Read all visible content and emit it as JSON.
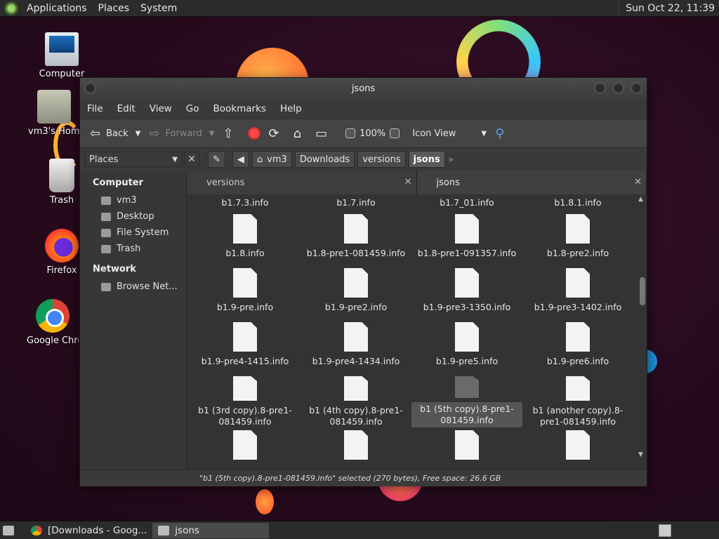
{
  "top_panel": {
    "menus": [
      "Applications",
      "Places",
      "System"
    ],
    "clock": "Sun Oct 22, 11:39"
  },
  "desktop_icons": [
    "Computer",
    "vm3's Home",
    "Trash",
    "Firefox",
    "Google Chrome"
  ],
  "window": {
    "title": "jsons",
    "menu": [
      "File",
      "Edit",
      "View",
      "Go",
      "Bookmarks",
      "Help"
    ],
    "toolbar": {
      "back": "Back",
      "forward": "Forward",
      "zoom": "100%",
      "view_mode": "Icon View"
    },
    "places_label": "Places",
    "breadcrumbs": [
      "vm3",
      "Downloads",
      "versions",
      "jsons"
    ],
    "sidebar": {
      "computer_header": "Computer",
      "computer_items": [
        "vm3",
        "Desktop",
        "File System",
        "Trash"
      ],
      "network_header": "Network",
      "network_items": [
        "Browse Net..."
      ]
    },
    "tabs": [
      "versions",
      "jsons"
    ],
    "top_row": [
      "b1.7.3.info",
      "b1.7.info",
      "b1.7_01.info",
      "b1.8.1.info"
    ],
    "files": [
      "b1.8.info",
      "b1.8-pre1-081459.info",
      "b1.8-pre1-091357.info",
      "b1.8-pre2.info",
      "b1.9-pre.info",
      "b1.9-pre2.info",
      "b1.9-pre3-1350.info",
      "b1.9-pre3-1402.info",
      "b1.9-pre4-1415.info",
      "b1.9-pre4-1434.info",
      "b1.9-pre5.info",
      "b1.9-pre6.info",
      "b1 (3rd copy).8-pre1-081459.info",
      "b1 (4th copy).8-pre1-081459.info",
      "b1 (5th copy).8-pre1-081459.info",
      "b1 (another copy).8-pre1-081459.info",
      "",
      "",
      "",
      ""
    ],
    "selected_file": "b1 (5th copy).8-pre1-081459.info",
    "status": "\"b1 (5th copy).8-pre1-081459.info\" selected (270 bytes), Free space: 26.6 GB"
  },
  "taskbar": {
    "tasks": [
      "[Downloads - Goog...",
      "jsons"
    ]
  }
}
